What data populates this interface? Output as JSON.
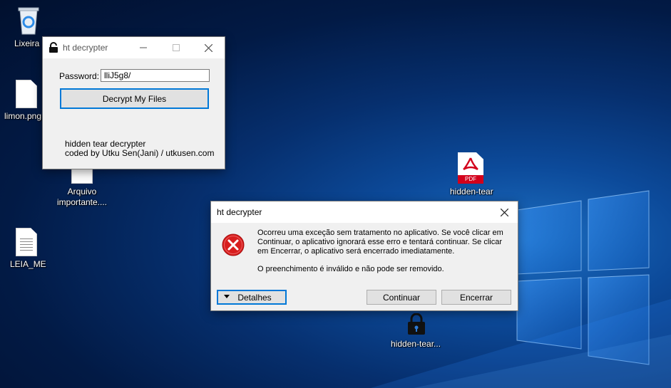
{
  "desktop": {
    "icons": [
      {
        "label": "Lixeira"
      },
      {
        "label": "limon.png"
      },
      {
        "label": "Arquivo importante...."
      },
      {
        "label": "LEIA_ME"
      },
      {
        "label": "hidden-tear"
      },
      {
        "label": "hidden-tear..."
      }
    ],
    "pdf_badge": "PDF"
  },
  "decrypter_window": {
    "title": "ht decrypter",
    "password_label": "Password:",
    "password_value": "lliJ5g8/",
    "decrypt_button": "Decrypt My Files",
    "credit_line1": "hidden tear decrypter",
    "credit_line2": "coded by Utku Sen(Jani) / utkusen.com"
  },
  "error_dialog": {
    "title": "ht decrypter",
    "message": "Ocorreu uma exceção sem tratamento no aplicativo. Se você clicar em Continuar, o aplicativo ignorará esse erro e tentará continuar. Se clicar em Encerrar, o aplicativo será encerrado imediatamente.",
    "detail": "O preenchimento é inválido e não pode ser removido.",
    "details_button": "Detalhes",
    "continue_button": "Continuar",
    "quit_button": "Encerrar"
  },
  "colors": {
    "accent": "#0078d7",
    "error_red": "#d81e1e",
    "pdf_red": "#d3001b"
  }
}
